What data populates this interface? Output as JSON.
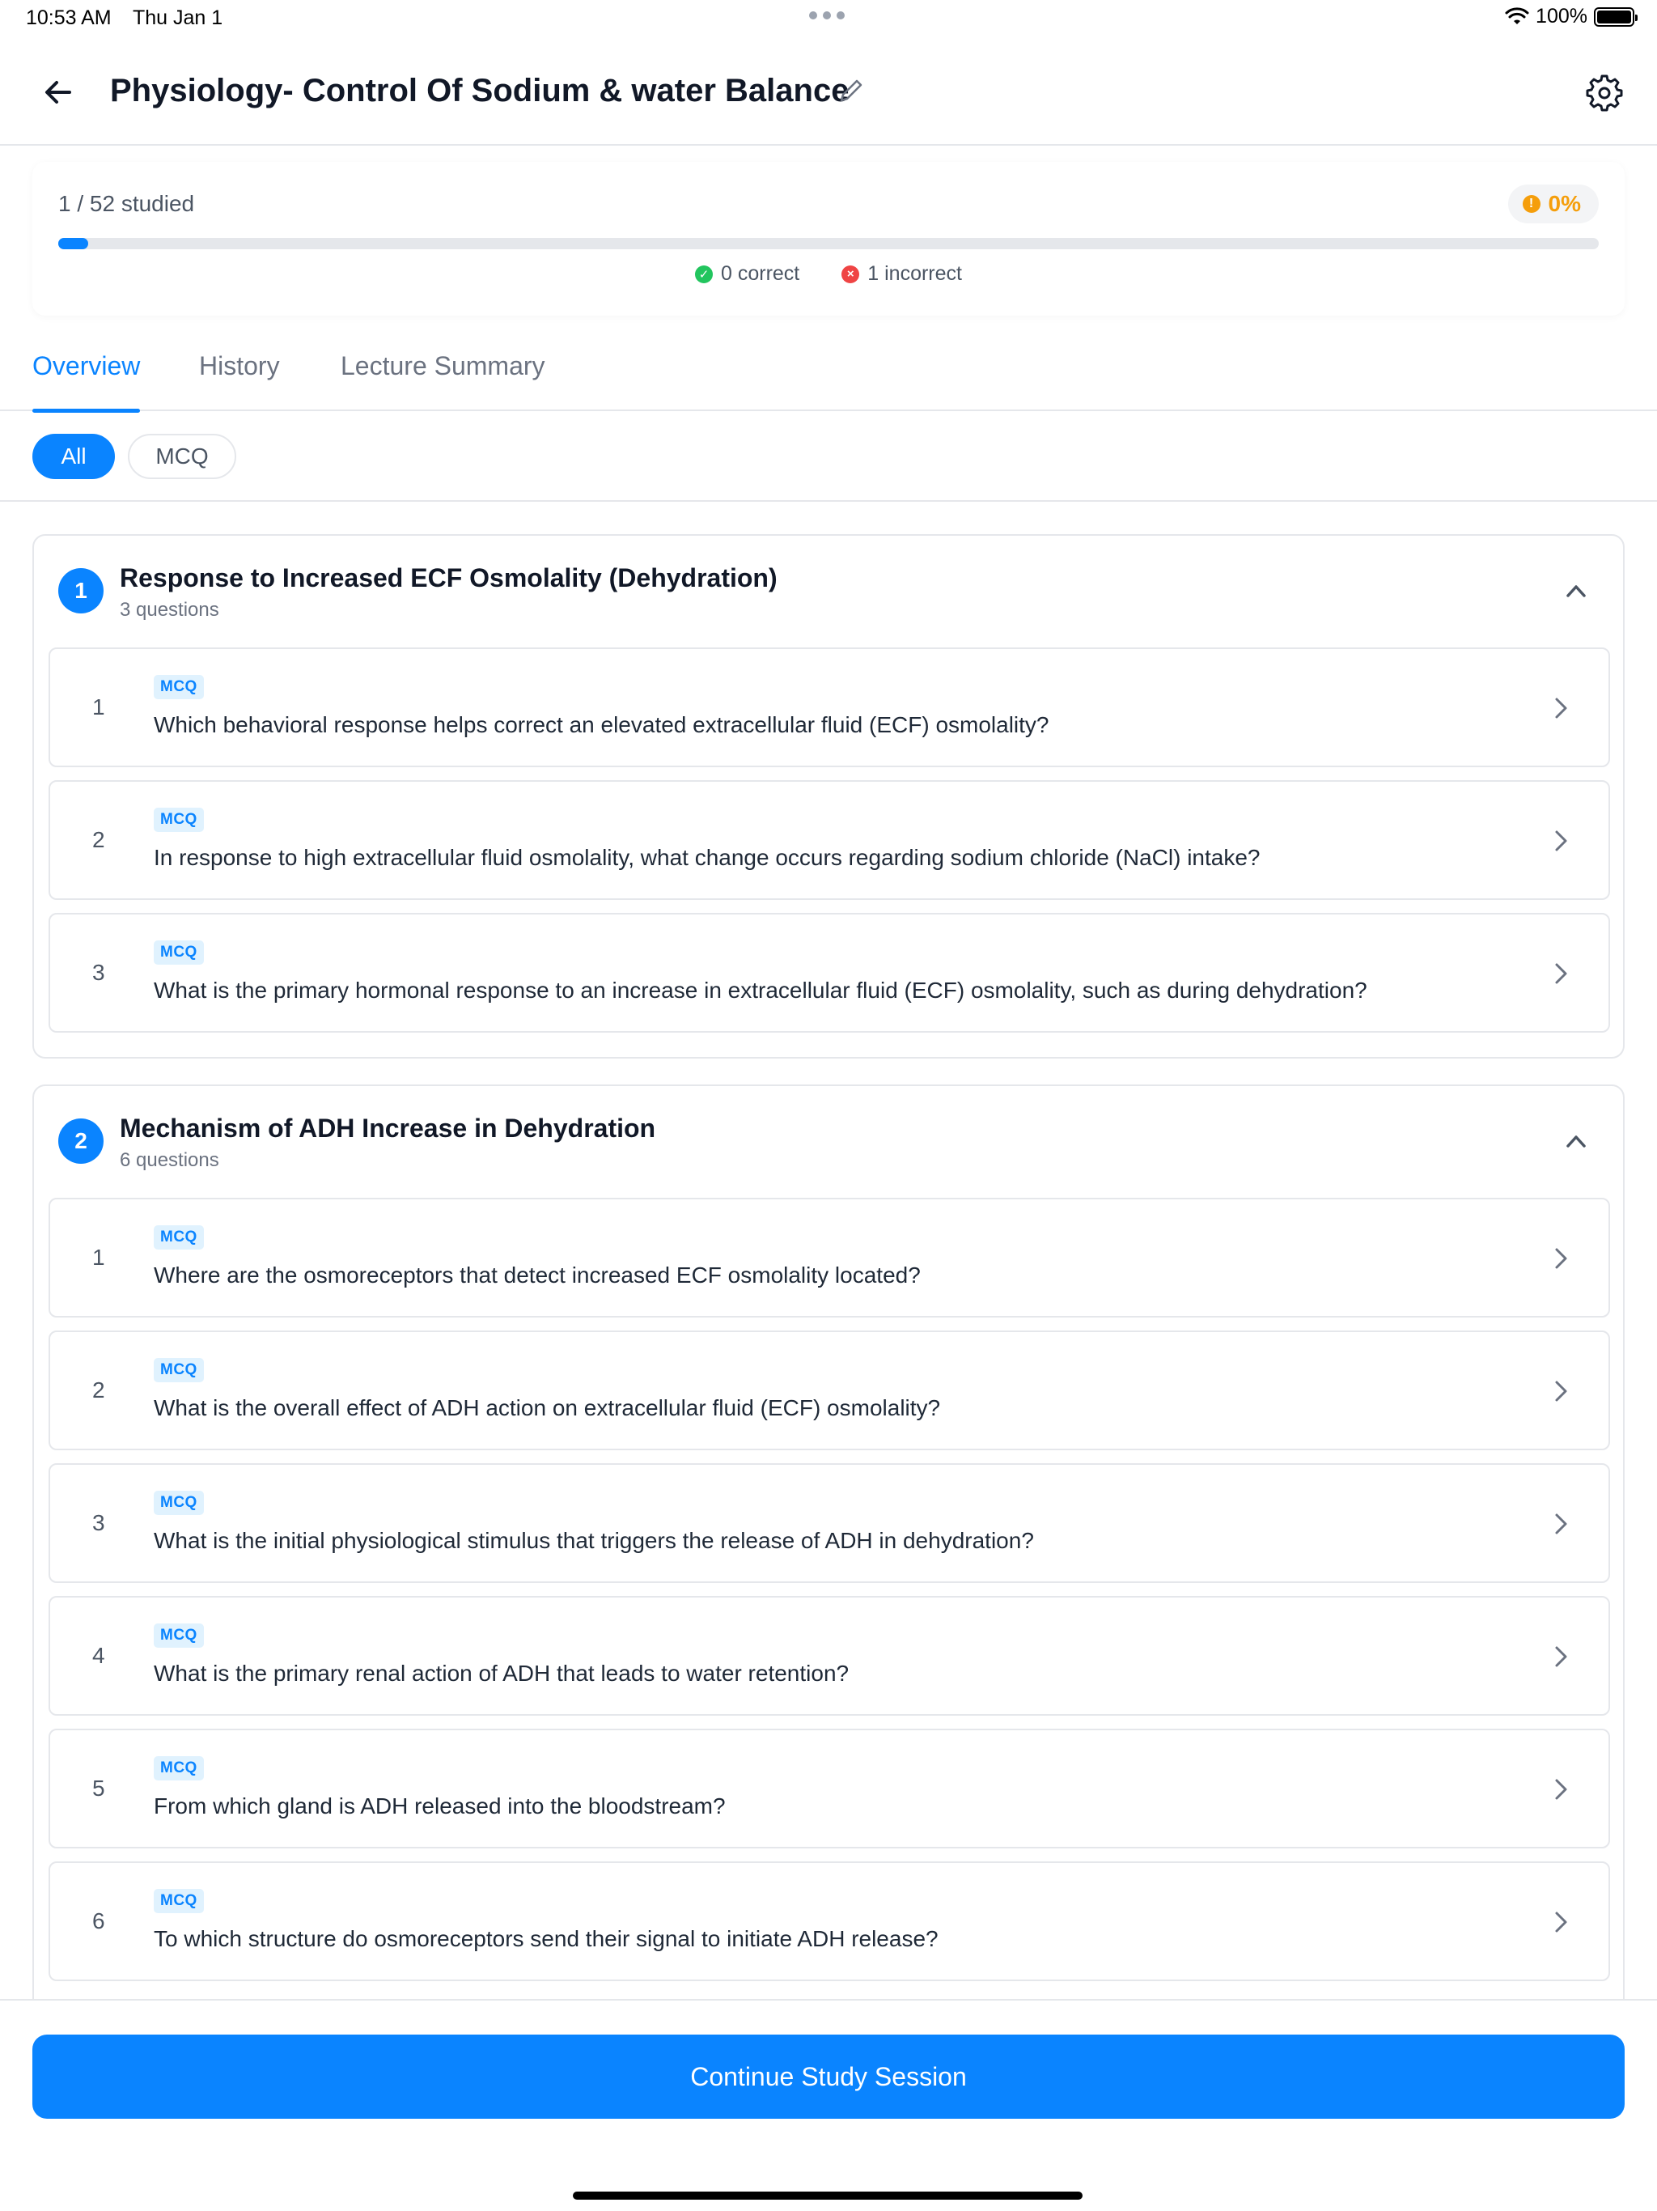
{
  "status_bar": {
    "time": "10:53 AM",
    "date": "Thu Jan 1",
    "battery": "100%"
  },
  "header": {
    "title": "Physiology- Control Of Sodium & water Balance"
  },
  "progress": {
    "studied_label": "1 / 52 studied",
    "percent_label": "0%",
    "fraction": 0.0192,
    "correct_label": "0 correct",
    "incorrect_label": "1 incorrect"
  },
  "tabs": [
    {
      "label": "Overview",
      "active": true
    },
    {
      "label": "History",
      "active": false
    },
    {
      "label": "Lecture Summary",
      "active": false
    }
  ],
  "filters": [
    {
      "label": "All",
      "active": true
    },
    {
      "label": "MCQ",
      "active": false
    }
  ],
  "sections": [
    {
      "number": "1",
      "title": "Response to Increased ECF Osmolality (Dehydration)",
      "subtitle": "3 questions",
      "questions": [
        {
          "number": "1",
          "type": "MCQ",
          "text": "Which behavioral response helps correct an elevated extracellular fluid (ECF) osmolality?"
        },
        {
          "number": "2",
          "type": "MCQ",
          "text": "In response to high extracellular fluid osmolality, what change occurs regarding sodium chloride (NaCl) intake?"
        },
        {
          "number": "3",
          "type": "MCQ",
          "text": "What is the primary hormonal response to an increase in extracellular fluid (ECF) osmolality, such as during dehydration?"
        }
      ]
    },
    {
      "number": "2",
      "title": "Mechanism of ADH Increase in Dehydration",
      "subtitle": "6 questions",
      "questions": [
        {
          "number": "1",
          "type": "MCQ",
          "text": "Where are the osmoreceptors that detect increased ECF osmolality located?"
        },
        {
          "number": "2",
          "type": "MCQ",
          "text": "What is the overall effect of ADH action on extracellular fluid (ECF) osmolality?"
        },
        {
          "number": "3",
          "type": "MCQ",
          "text": "What is the initial physiological stimulus that triggers the release of ADH in dehydration?"
        },
        {
          "number": "4",
          "type": "MCQ",
          "text": "What is the primary renal action of ADH that leads to water retention?"
        },
        {
          "number": "5",
          "type": "MCQ",
          "text": "From which gland is ADH released into the bloodstream?"
        },
        {
          "number": "6",
          "type": "MCQ",
          "text": "To which structure do osmoreceptors send their signal to initiate ADH release?"
        }
      ]
    }
  ],
  "cta": {
    "label": "Continue Study Session"
  },
  "colors": {
    "accent": "#0a84ff",
    "warning": "#f59e0b",
    "success": "#22c55e",
    "error": "#ef4444"
  },
  "icons": [
    "back-arrow-icon",
    "pencil-icon",
    "gear-icon",
    "warning-icon",
    "check-circle-icon",
    "x-circle-icon",
    "chevron-up-icon",
    "chevron-right-icon",
    "wifi-icon",
    "battery-icon"
  ]
}
